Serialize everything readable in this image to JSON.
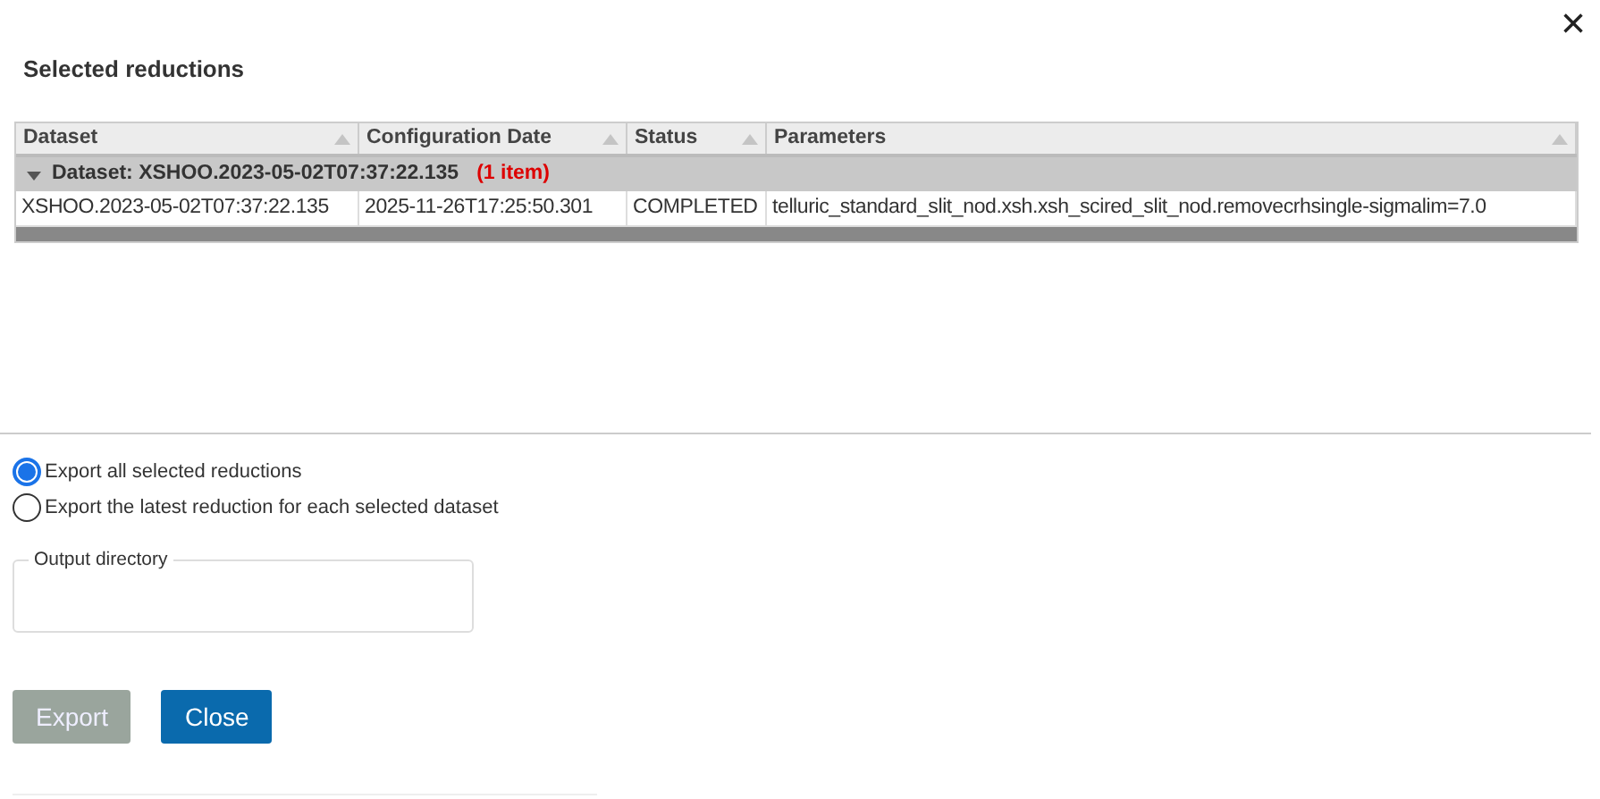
{
  "dialog": {
    "title": "Selected reductions",
    "close_icon": "×"
  },
  "table": {
    "columns": [
      "Dataset",
      "Configuration Date",
      "Status",
      "Parameters"
    ],
    "groups": [
      {
        "label": "Dataset: XSHOO.2023-05-02T07:37:22.135",
        "count": "(1 item)",
        "expanded": true,
        "rows": [
          {
            "cells": [
              "XSHOO.2023-05-02T07:37:22.135",
              "2025-11-26T17:25:50.301",
              "COMPLETED",
              "telluric_standard_slit_nod.xsh.xsh_scired_slit_nod.removecrhsingle-sigmalim=7.0"
            ]
          }
        ]
      }
    ]
  },
  "export_options": [
    {
      "label": "Export all selected reductions",
      "selected": true
    },
    {
      "label": "Export the latest reduction for each selected dataset",
      "selected": false
    }
  ],
  "output_directory": {
    "label": "Output directory"
  },
  "buttons": [
    {
      "label": "Export",
      "disabled": true
    },
    {
      "label": "Close",
      "disabled": false
    }
  ]
}
